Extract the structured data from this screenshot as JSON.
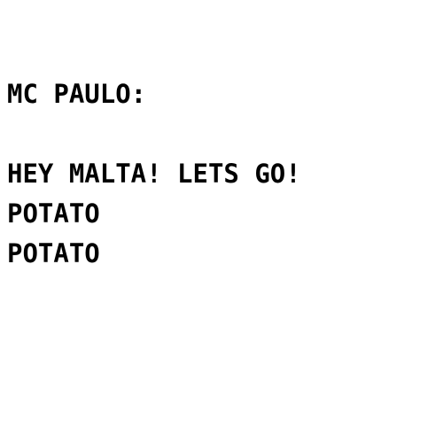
{
  "dialog": {
    "speaker": "MC PAULO:",
    "lines": [
      "HEY MALTA! LETS GO!",
      "POTATO",
      "POTATO"
    ]
  },
  "colors": {
    "background": "#ffffff",
    "text": "#000000"
  }
}
